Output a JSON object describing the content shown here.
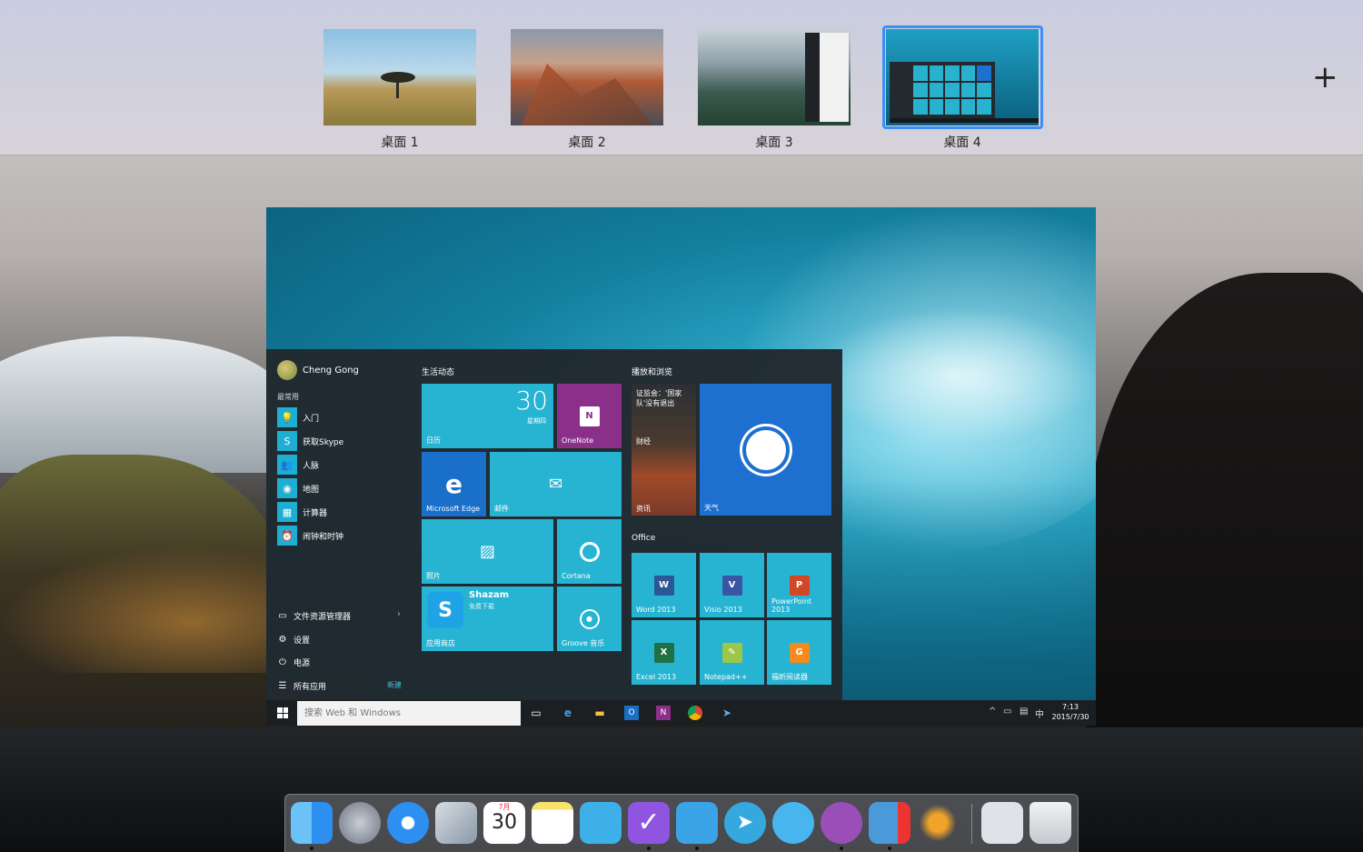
{
  "spaces": {
    "desktops": [
      {
        "label": "桌面 1"
      },
      {
        "label": "桌面 2"
      },
      {
        "label": "桌面 3"
      },
      {
        "label": "桌面 4",
        "selected": true
      }
    ],
    "add_icon": "plus-icon",
    "selected_color": "#3f8ef7"
  },
  "start_menu": {
    "user_name": "Cheng Gong",
    "most_used_label": "最常用",
    "apps": [
      {
        "label": "入门",
        "icon": "lightbulb-icon"
      },
      {
        "label": "获取Skype",
        "icon": "skype-icon"
      },
      {
        "label": "人脉",
        "icon": "people-icon"
      },
      {
        "label": "地图",
        "icon": "map-icon"
      },
      {
        "label": "计算器",
        "icon": "calculator-icon"
      },
      {
        "label": "闹钟和时钟",
        "icon": "alarm-icon"
      }
    ],
    "system": [
      {
        "label": "文件资源管理器",
        "icon": "folder-icon"
      },
      {
        "label": "设置",
        "icon": "gear-icon"
      },
      {
        "label": "电源",
        "icon": "power-icon"
      },
      {
        "label": "所有应用",
        "icon": "list-icon"
      }
    ],
    "new_badge": "新建",
    "groups": {
      "life": "生活动态",
      "play": "播放和浏览",
      "office": "Office"
    },
    "tiles": {
      "calendar": {
        "label": "日历",
        "day": "30",
        "weekday": "星期四"
      },
      "onenote": {
        "label": "OneNote"
      },
      "edge": {
        "label": "Microsoft Edge"
      },
      "mail": {
        "label": "邮件"
      },
      "photos": {
        "label": "照片"
      },
      "cortana": {
        "label": "Cortana"
      },
      "store": {
        "label": "应用商店",
        "app_title": "Shazam",
        "app_sub": "免费下载"
      },
      "groove": {
        "label": "Groove 音乐"
      },
      "news_headline": "证监会：'国家队'没有退出",
      "finance": {
        "label": "财经"
      },
      "news": {
        "label": "资讯"
      },
      "weather": {
        "label": "天气"
      },
      "word": {
        "label": "Word 2013"
      },
      "visio": {
        "label": "Visio 2013"
      },
      "powerpoint": {
        "label": "PowerPoint 2013"
      },
      "excel": {
        "label": "Excel 2013"
      },
      "notepad": {
        "label": "Notepad++"
      },
      "foxit": {
        "label": "福昕阅读器"
      }
    },
    "accent": "#26b4d2"
  },
  "taskbar": {
    "search_placeholder": "搜索 Web 和 Windows",
    "ime": "中",
    "time": "7:13",
    "date": "2015/7/30"
  },
  "dock": {
    "apps": [
      {
        "name": "finder-icon",
        "color": "#3a9af0"
      },
      {
        "name": "launchpad-icon",
        "color": "#8c97a5"
      },
      {
        "name": "safari-icon",
        "color": "#2d8ff0"
      },
      {
        "name": "mail-hawk-icon",
        "color": "#b9c6d3"
      },
      {
        "name": "calendar-icon",
        "color": "#ffffff",
        "month": "7月",
        "day": "30"
      },
      {
        "name": "notes-icon",
        "color": "#f7e36b"
      },
      {
        "name": "book-icon",
        "color": "#3db0ea"
      },
      {
        "name": "tasks-icon",
        "color": "#8f55e0"
      },
      {
        "name": "tweetbot-icon",
        "color": "#3aa4e6"
      },
      {
        "name": "telegram-icon",
        "color": "#35a8e0"
      },
      {
        "name": "messages-icon",
        "color": "#48b5ef"
      },
      {
        "name": "screen-sharing-icon",
        "color": "#9a4fb8"
      },
      {
        "name": "parallels-icon",
        "color": "#4a9ad9"
      },
      {
        "name": "tes-icon",
        "color": "#f0a32a"
      },
      {
        "name": "preview-icon",
        "color": "#dfe3e7"
      },
      {
        "name": "trash-icon",
        "color": "#d9dce0"
      }
    ]
  }
}
